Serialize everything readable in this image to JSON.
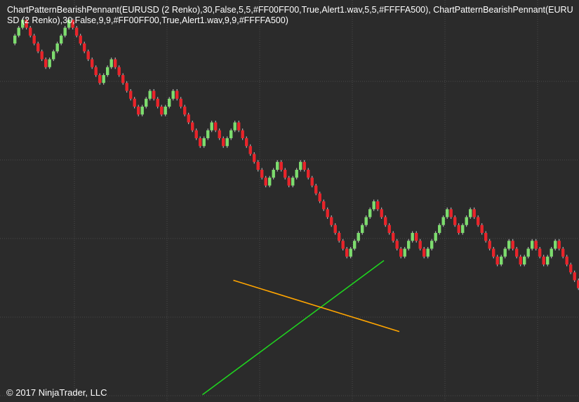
{
  "indicator_label": "ChartPatternBearishPennant(EURUSD (2 Renko),30,False,5,5,#FF00FF00,True,Alert1.wav,5,5,#FFFFA500), ChartPatternBearishPennant(EURUSD (2 Renko),30,False,9,9,#FF00FF00,True,Alert1.wav,9,9,#FFFFA500)",
  "copyright": "© 2017 NinjaTrader, LLC",
  "colors": {
    "background": "#2b2b2b",
    "grid": "#4a4a4a",
    "up_brick": "#7ddc6e",
    "down_brick": "#e8242a",
    "wick": "#c8c8c8",
    "support_line": "#1fd41f",
    "resistance_line": "#ffa500"
  },
  "chart_data": {
    "type": "renko",
    "instrument": "EURUSD",
    "brick_size": 2,
    "y_start": 0,
    "moves": [
      3,
      -6,
      6,
      -8,
      3,
      -7,
      3,
      -3,
      3,
      -7,
      3,
      -3,
      3,
      -8,
      3,
      -3,
      3,
      -12,
      7,
      -7,
      3,
      -3,
      6,
      -3,
      3,
      -7,
      3,
      -3,
      3,
      -3,
      3,
      -10,
      3,
      -3,
      4,
      -3,
      3,
      -4,
      3,
      -5,
      3,
      -3,
      3,
      -3,
      4,
      -5,
      6,
      -3,
      3,
      -3,
      4,
      -3,
      3,
      -3,
      4
    ],
    "support_line": {
      "from": {
        "brick": 49,
        "y": -44.5
      },
      "to": {
        "brick": 96,
        "y": -27.5
      }
    },
    "resistance_line": {
      "from": {
        "brick": 57,
        "y": -30
      },
      "to": {
        "brick": 100,
        "y": -36.5
      }
    },
    "grid": true
  }
}
